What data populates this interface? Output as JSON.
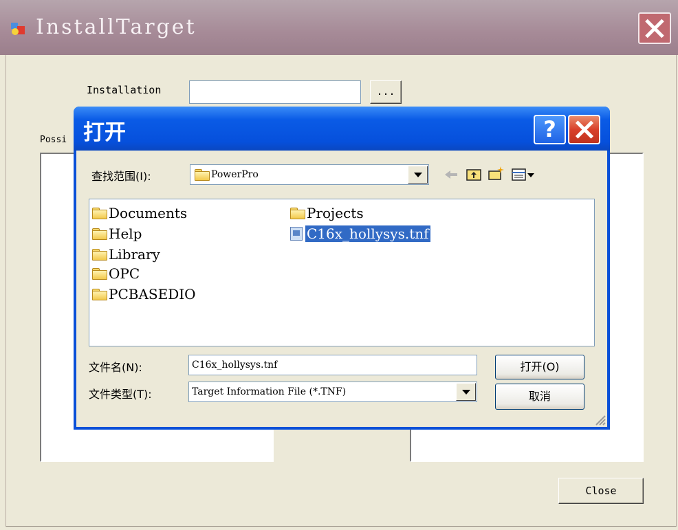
{
  "outer_window": {
    "title": "InstallTarget",
    "installation_label": "Installation",
    "installation_value": "",
    "browse_label": "...",
    "possible_label": "Possi",
    "close_label": "Close"
  },
  "open_dialog": {
    "title": "打开",
    "help_label": "?",
    "look_in_label": "查找范围(I):",
    "look_in_value": "PowerPro",
    "files": [
      {
        "name": "Documents",
        "type": "folder"
      },
      {
        "name": "Help",
        "type": "folder"
      },
      {
        "name": "Library",
        "type": "folder"
      },
      {
        "name": "OPC",
        "type": "folder"
      },
      {
        "name": "PCBASEDIO",
        "type": "folder"
      },
      {
        "name": "Projects",
        "type": "folder"
      },
      {
        "name": "C16x_hollysys.tnf",
        "type": "file",
        "selected": true
      }
    ],
    "filename_label": "文件名(N):",
    "filename_value": "C16x_hollysys.tnf",
    "filetype_label": "文件类型(T):",
    "filetype_value": "Target Information File (*.TNF)",
    "open_button": "打开(O)",
    "cancel_button": "取消"
  },
  "icons": [
    "app-icon",
    "close-icon",
    "help-icon",
    "folder-icon",
    "back-arrow-icon",
    "up-folder-icon",
    "new-folder-icon",
    "view-menu-icon",
    "file-icon",
    "chevron-down-icon"
  ],
  "colors": {
    "title_bar": "#a68a97",
    "dialog_title": "#0a5be6",
    "selection": "#316ac5",
    "background": "#ece9d8"
  }
}
